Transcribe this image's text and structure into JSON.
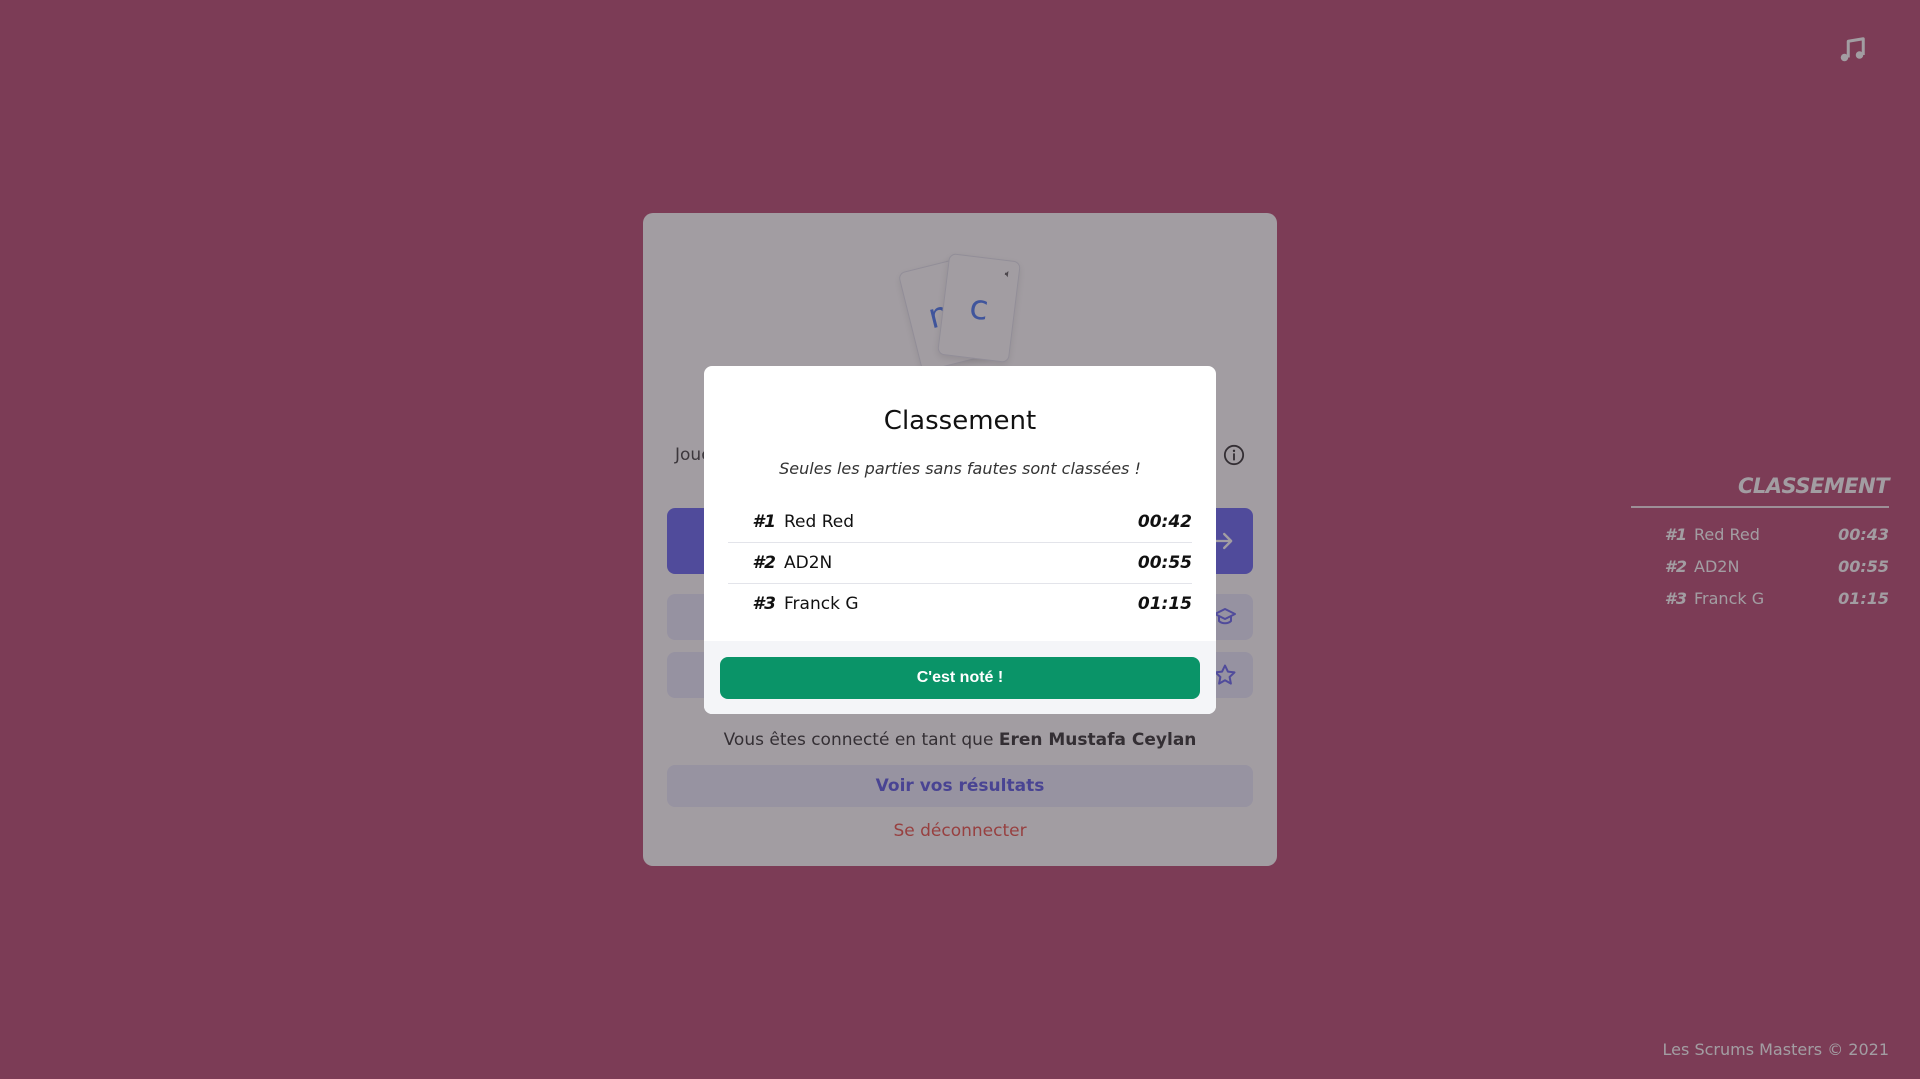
{
  "colors": {
    "background": "#b33c66",
    "primary": "#5b5bf0",
    "success": "#0a9468",
    "danger": "#e8443a"
  },
  "music": {
    "icon": "music-note-icon"
  },
  "logo": {
    "letter_1": "m",
    "letter_2": "c"
  },
  "main": {
    "play_text": "Joue",
    "connected_prefix": "Vous êtes connecté en tant que",
    "user_name": "Eren Mustafa Ceylan",
    "results_button": "Voir vos résultats",
    "logout_link": "Se déconnecter"
  },
  "side_leaderboard": {
    "title": "CLASSEMENT",
    "rows": [
      {
        "rank": "#1",
        "name": "Red Red",
        "time": "00:43"
      },
      {
        "rank": "#2",
        "name": "AD2N",
        "time": "00:55"
      },
      {
        "rank": "#3",
        "name": "Franck G",
        "time": "01:15"
      }
    ]
  },
  "footer": {
    "copyright": "Les Scrums Masters © 2021"
  },
  "modal": {
    "title": "Classement",
    "subtitle": "Seules les parties sans fautes sont classées !",
    "rows": [
      {
        "rank": "#1",
        "name": "Red Red",
        "time": "00:42"
      },
      {
        "rank": "#2",
        "name": "AD2N",
        "time": "00:55"
      },
      {
        "rank": "#3",
        "name": "Franck G",
        "time": "01:15"
      }
    ],
    "ok_button": "C'est noté !"
  }
}
